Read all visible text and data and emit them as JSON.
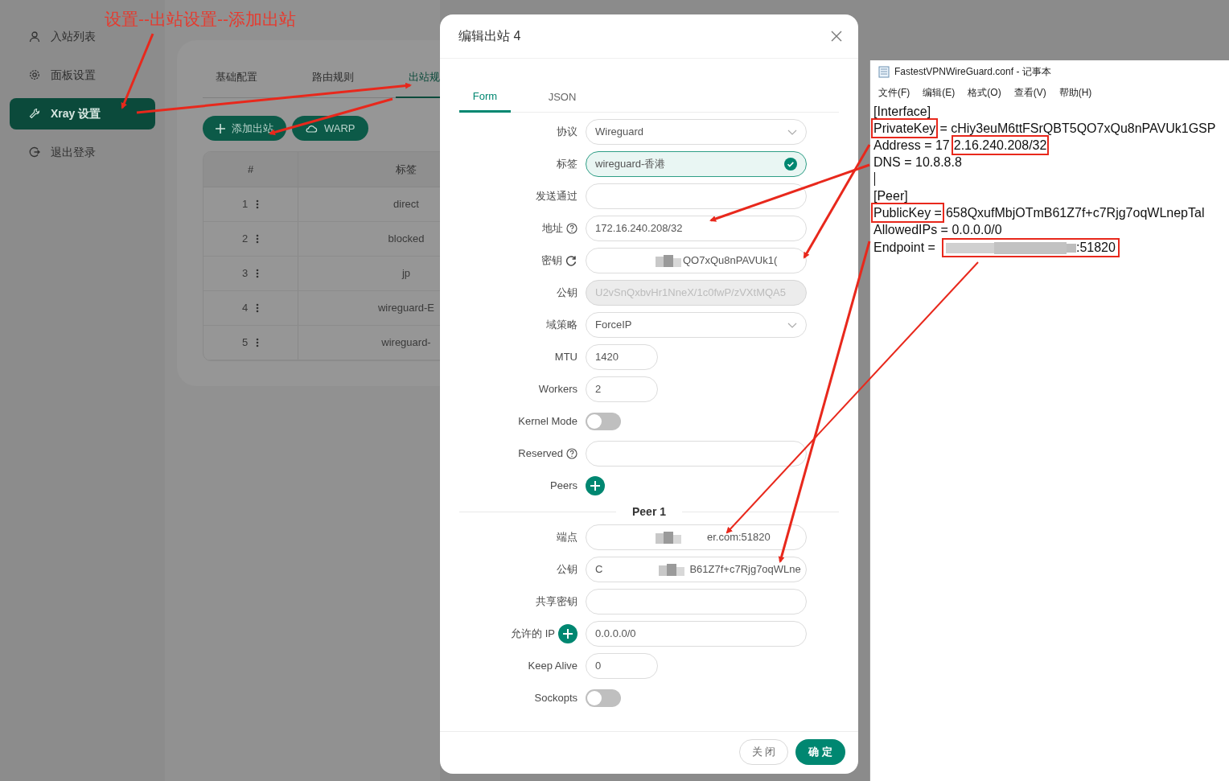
{
  "annotation": {
    "text": "设置--出站设置--添加出站"
  },
  "sidebar": {
    "items": [
      {
        "label": "入站列表",
        "selected": false
      },
      {
        "label": "面板设置",
        "selected": false
      },
      {
        "label": "Xray 设置",
        "selected": true
      },
      {
        "label": "退出登录",
        "selected": false
      }
    ]
  },
  "settings": {
    "tabs": [
      {
        "label": "基础配置",
        "selected": false
      },
      {
        "label": "路由规则",
        "selected": false
      },
      {
        "label": "出站规",
        "selected": true
      }
    ],
    "buttons": [
      {
        "label": "添加出站"
      },
      {
        "label": "WARP"
      }
    ],
    "table": {
      "columns": [
        "#",
        "标签"
      ],
      "rows": [
        {
          "index": "1",
          "tag": "direct"
        },
        {
          "index": "2",
          "tag": "blocked"
        },
        {
          "index": "3",
          "tag": "jp"
        },
        {
          "index": "4",
          "tag": "wireguard-E"
        },
        {
          "index": "5",
          "tag": "wireguard-"
        }
      ]
    }
  },
  "modal": {
    "title": "编辑出站 4",
    "tabs": [
      {
        "label": "Form",
        "selected": true
      },
      {
        "label": "JSON",
        "selected": false
      }
    ],
    "fields": [
      {
        "label": "协议",
        "kind": "select",
        "value": "Wireguard"
      },
      {
        "label": "标签",
        "kind": "input",
        "value": "wireguard-香港",
        "validated": true,
        "disabled": false,
        "redacted": false
      },
      {
        "label": "发送通过",
        "kind": "input",
        "validated": false,
        "disabled": false,
        "redacted": false
      },
      {
        "label": "地址",
        "kind": "input",
        "value": "172.16.240.208/32",
        "validated": false,
        "disabled": false,
        "redacted": false
      },
      {
        "label": "密钥",
        "kind": "input",
        "value": "QO7xQu8nPAVUk1(",
        "validated": false,
        "disabled": false,
        "redacted": true
      },
      {
        "label": "公钥",
        "kind": "input",
        "value": "U2vSnQxbvHr1NneX/1c0fwP/zVXtMQA5",
        "validated": false,
        "disabled": true,
        "redacted": false
      },
      {
        "label": "域策略",
        "kind": "select",
        "value": "ForceIP"
      },
      {
        "label": "MTU",
        "kind": "short",
        "value": "1420"
      },
      {
        "label": "Workers",
        "kind": "short",
        "value": "2"
      },
      {
        "label": "Kernel Mode",
        "kind": "switch",
        "on": false
      },
      {
        "label": "Reserved",
        "kind": "input",
        "validated": false,
        "disabled": false,
        "redacted": false
      },
      {
        "label": "Peers",
        "kind": "add"
      }
    ],
    "peer_title": "Peer 1",
    "peer_fields": [
      {
        "label": "端点",
        "kind": "input",
        "value": "er.com:51820",
        "validated": false,
        "disabled": false,
        "redacted": true
      },
      {
        "label": "公钥",
        "kind": "input",
        "prefix": "C",
        "value": "B61Z7f+c7Rjg7oqWLne",
        "validated": false,
        "disabled": false,
        "redacted": true
      },
      {
        "label": "共享密钥",
        "kind": "input",
        "validated": false,
        "disabled": false,
        "redacted": false
      },
      {
        "label": "允许的 IP",
        "kind": "input",
        "value": "0.0.0.0/0",
        "validated": false,
        "disabled": false,
        "redacted": false
      },
      {
        "label": "Keep Alive",
        "kind": "short",
        "value": "0"
      },
      {
        "label": "Sockopts",
        "kind": "switch",
        "on": false
      }
    ],
    "buttons": [
      {
        "label": "关 闭",
        "primary": false
      },
      {
        "label": "确 定",
        "primary": true
      }
    ]
  },
  "notepad": {
    "title": "FastestVPNWireGuard.conf - 记事本",
    "menu": [
      "文件(F)",
      "编辑(E)",
      "格式(O)",
      "查看(V)",
      "帮助(H)"
    ],
    "lines": [
      {
        "kind": "text",
        "segments": [
          {
            "text": "[Interface]",
            "highlighted": false
          }
        ]
      },
      {
        "kind": "text",
        "segments": [
          {
            "text": "PrivateKey",
            "highlighted": true
          },
          {
            "text": "= cHiy3euM6ttFSrQBT5QO7xQu8nPAVUk1GSP",
            "highlighted": false
          }
        ]
      },
      {
        "kind": "text",
        "segments": [
          {
            "text": "Address = 17",
            "highlighted": false
          },
          {
            "text": "2.16.240.208/32",
            "highlighted": true
          }
        ]
      },
      {
        "kind": "text",
        "segments": [
          {
            "text": "DNS = 10.8.8.8",
            "highlighted": false
          }
        ]
      },
      {
        "kind": "cursor"
      },
      {
        "kind": "text",
        "segments": [
          {
            "text": "[Peer]",
            "highlighted": false
          }
        ]
      },
      {
        "kind": "text",
        "segments": [
          {
            "text": "PublicKey =",
            "highlighted": true
          },
          {
            "text": "658QxufMbjOTmB61Z7f+c7Rjg7oqWLnepTal",
            "highlighted": false
          }
        ]
      },
      {
        "kind": "text",
        "segments": [
          {
            "text": "AllowedIPs = 0.0.0.0/0",
            "highlighted": false
          }
        ]
      },
      {
        "kind": "redacted",
        "before": "Endpoint =",
        "after": ":51820",
        "highlighted": true
      }
    ]
  }
}
